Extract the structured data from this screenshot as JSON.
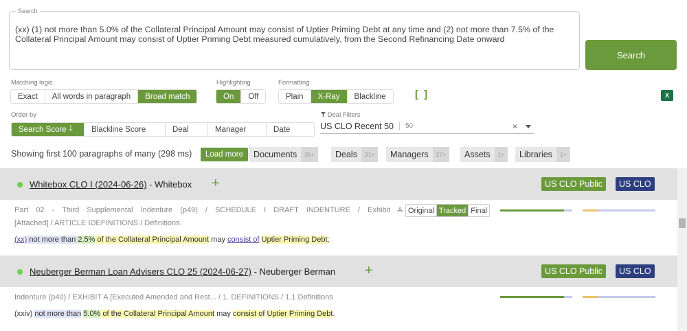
{
  "search": {
    "legend": "Search",
    "query": "(xx) (1) not more than 5.0% of the Collateral Principal Amount may consist of Uptier Priming Debt at any time and (2) not more than 7.5% of the Collateral Principal Amount may consist of Uptier Priming Debt measured cumulatively, from the Second Refinancing Date onward",
    "button_label": "Search"
  },
  "matching_logic": {
    "label": "Matching logic",
    "options": [
      "Exact",
      "All words in paragraph",
      "Broad match"
    ],
    "selected": "Broad match"
  },
  "highlighting": {
    "label": "Highlighting",
    "options": [
      "On",
      "Off"
    ],
    "selected": "On"
  },
  "formatting": {
    "label": "Formatting",
    "options": [
      "Plain",
      "X-Ray",
      "Blackline"
    ],
    "selected": "X-Ray",
    "brackets": "[ ]"
  },
  "export": {
    "icon": "excel-icon",
    "glyph": "X"
  },
  "order_by": {
    "label": "Order by",
    "options": [
      "Search Score",
      "Blackline Score",
      "Deal",
      "Manager",
      "Date"
    ],
    "selected": "Search Score",
    "arrow": "🡓"
  },
  "deal_filter": {
    "label": "Deal Filters",
    "value": "US CLO Recent 50",
    "count": "50",
    "clear": "×"
  },
  "results_summary": {
    "showing": "Showing first 100 paragraphs of many (298 ms)",
    "load_more": "Load more",
    "facets": [
      {
        "name": "Documents",
        "count": "35+"
      },
      {
        "name": "Deals",
        "count": "31+"
      },
      {
        "name": "Managers",
        "count": "27+"
      },
      {
        "name": "Assets",
        "count": "1+"
      },
      {
        "name": "Libraries",
        "count": "1+"
      }
    ]
  },
  "results": [
    {
      "deal": "Whitebox CLO I (2024-06-26)",
      "manager": " - Whitebox",
      "plus": "+",
      "badges": [
        "US CLO Public",
        "US CLO"
      ],
      "breadcrumb_line1": "Part 02 - Third Supplemental Indenture (p49) / SCHEDULE I DRAFT INDENTURE / Exhibit A",
      "breadcrumb_line2": "[Attached] / ARTICLE IDEFINITIONS / Definitions.",
      "versions": [
        "Original",
        "Tracked",
        "Final"
      ],
      "version_selected": "Tracked",
      "snippet": {
        "lead": "(xx)",
        "p1": " not more than ",
        "num": "2.5%",
        "p2": " of the Collateral Principal Amount",
        "p3": " may ",
        "p4": "consist of",
        "p5": " ",
        "p6": "Uptier Priming Debt",
        "end": ";"
      }
    },
    {
      "deal": "Neuberger Berman Loan Advisers CLO 25 (2024-06-27)",
      "manager": " - Neuberger Berman",
      "plus": "+",
      "badges": [
        "US CLO Public",
        "US CLO"
      ],
      "breadcrumb": "Indenture (p40) / EXHIBIT A [Executed Amended and Rest... / 1. DEFINITIONS / 1.1 Definitions",
      "snippet": {
        "lead": "(xxiv) ",
        "p1": "not more than",
        "s1": " ",
        "num": "5.0%",
        "p2": " of the ",
        "p3": "Collateral Principal Amount",
        "p4": " may ",
        "p5": "consist of",
        "p6": " ",
        "p7": "Uptier Priming Debt",
        "end": "."
      }
    }
  ],
  "colors": {
    "accent": "#6b9a3c",
    "badge_navy": "#2e3f7f",
    "status_dot": "#6dcf4a"
  }
}
